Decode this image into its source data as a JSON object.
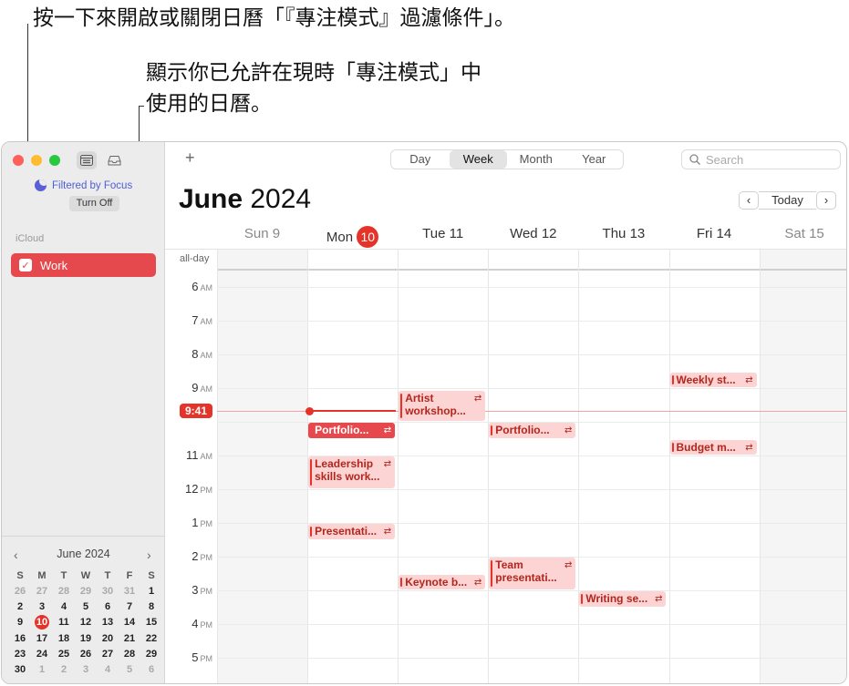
{
  "callouts": {
    "top": "按一下來開啟或關閉日曆「『專注模式』過濾條件」。",
    "middle_line1": "顯示你已允許在現時「專注模式」中",
    "middle_line2": "使用的日曆。"
  },
  "sidebar": {
    "filtered_label": "Filtered by Focus",
    "turn_off_label": "Turn Off",
    "section": "iCloud",
    "calendar_name": "Work",
    "accent": "#e5484d"
  },
  "mini_calendar": {
    "title": "June 2024",
    "weekday_headers": [
      "S",
      "M",
      "T",
      "W",
      "T",
      "F",
      "S"
    ],
    "weeks": [
      [
        "26",
        "27",
        "28",
        "29",
        "30",
        "31",
        "1"
      ],
      [
        "2",
        "3",
        "4",
        "5",
        "6",
        "7",
        "8"
      ],
      [
        "9",
        "10",
        "11",
        "12",
        "13",
        "14",
        "15"
      ],
      [
        "16",
        "17",
        "18",
        "19",
        "20",
        "21",
        "22"
      ],
      [
        "23",
        "24",
        "25",
        "26",
        "27",
        "28",
        "29"
      ],
      [
        "30",
        "1",
        "2",
        "3",
        "4",
        "5",
        "6"
      ]
    ],
    "today": "10"
  },
  "toolbar": {
    "add": "+",
    "views": [
      "Day",
      "Week",
      "Month",
      "Year"
    ],
    "active_view": "Week",
    "search_placeholder": "Search",
    "today_label": "Today",
    "prev": "‹",
    "next": "›"
  },
  "header": {
    "month": "June",
    "year": "2024"
  },
  "days": [
    {
      "name": "Sun",
      "num": "9"
    },
    {
      "name": "Mon",
      "num": "10"
    },
    {
      "name": "Tue",
      "num": "11"
    },
    {
      "name": "Wed",
      "num": "12"
    },
    {
      "name": "Thu",
      "num": "13"
    },
    {
      "name": "Fri",
      "num": "14"
    },
    {
      "name": "Sat",
      "num": "15"
    }
  ],
  "allday_label": "all-day",
  "hours": [
    {
      "h": "6",
      "ap": "AM"
    },
    {
      "h": "7",
      "ap": "AM"
    },
    {
      "h": "8",
      "ap": "AM"
    },
    {
      "h": "9",
      "ap": "AM"
    },
    {
      "h": "",
      "ap": ""
    },
    {
      "h": "11",
      "ap": "AM"
    },
    {
      "h": "12",
      "ap": "PM"
    },
    {
      "h": "1",
      "ap": "PM"
    },
    {
      "h": "2",
      "ap": "PM"
    },
    {
      "h": "3",
      "ap": "PM"
    },
    {
      "h": "4",
      "ap": "PM"
    },
    {
      "h": "5",
      "ap": "PM"
    }
  ],
  "current_time": "9:41",
  "events": [
    {
      "day": 1,
      "start": 10.0,
      "end": 10.5,
      "lines": [
        "Portfolio..."
      ],
      "solid": true
    },
    {
      "day": 1,
      "start": 11.0,
      "end": 12.0,
      "lines": [
        "Leadership",
        "skills work..."
      ]
    },
    {
      "day": 1,
      "start": 13.0,
      "end": 13.5,
      "lines": [
        "Presentati..."
      ]
    },
    {
      "day": 2,
      "start": 9.05,
      "end": 10.0,
      "lines": [
        "Artist",
        "workshop..."
      ]
    },
    {
      "day": 2,
      "start": 14.5,
      "end": 15.0,
      "lines": [
        "Keynote b..."
      ]
    },
    {
      "day": 3,
      "start": 10.0,
      "end": 10.5,
      "lines": [
        "Portfolio..."
      ]
    },
    {
      "day": 3,
      "start": 14.0,
      "end": 15.0,
      "lines": [
        "Team",
        "presentati..."
      ]
    },
    {
      "day": 4,
      "start": 15.0,
      "end": 15.5,
      "lines": [
        "Writing se..."
      ]
    },
    {
      "day": 5,
      "start": 8.5,
      "end": 9.0,
      "lines": [
        "Weekly st..."
      ]
    },
    {
      "day": 5,
      "start": 10.5,
      "end": 11.0,
      "lines": [
        "Budget m..."
      ]
    }
  ]
}
